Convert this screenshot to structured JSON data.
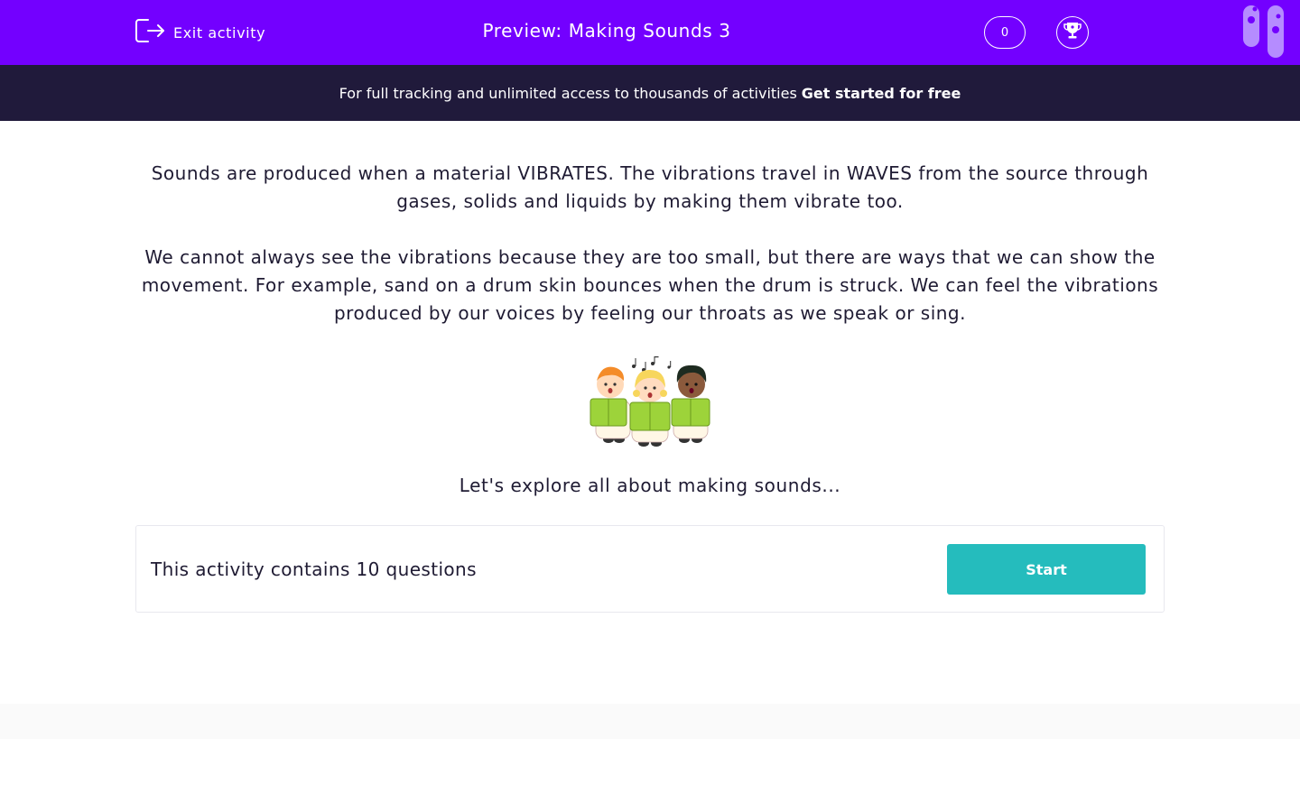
{
  "header": {
    "exit_label": "Exit activity",
    "exit_icon": "exit-icon",
    "title": "Preview: Making Sounds 3",
    "score": "0",
    "trophy_icon": "trophy-icon",
    "colors": {
      "background": "#7300ff",
      "text": "#ffffff"
    }
  },
  "banner": {
    "text": "For full tracking and unlimited access to thousands of activities",
    "link_label": "Get started for free",
    "colors": {
      "background": "#201a3b"
    }
  },
  "content": {
    "paragraph_1": "Sounds are produced when a material VIBRATES. The vibrations travel in WAVES from the source through gases, solids and liquids by making them vibrate too.",
    "paragraph_2": "We cannot always see the vibrations because they are too small, but there are ways that we can show the movement. For example, sand on a drum skin bounces when the drum is struck. We can feel the vibrations produced by our voices by feeling our throats as we speak or sing.",
    "illustration": "three-children-singing",
    "tagline": "Let's explore all about making sounds..."
  },
  "activity_card": {
    "summary": "This activity contains 10 questions",
    "start_label": "Start",
    "colors": {
      "button": "#25bcbd"
    }
  }
}
